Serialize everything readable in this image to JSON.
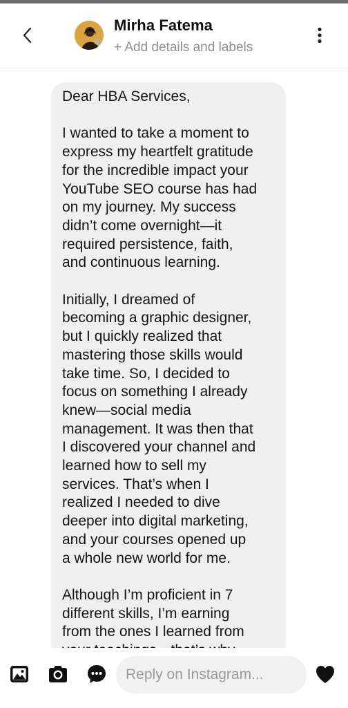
{
  "header": {
    "name": "Mirha Fatema",
    "subtitle": "+ Add details and labels"
  },
  "icons": {
    "back": "chevron-left-icon",
    "more": "vertical-ellipsis-icon",
    "gallery": "gallery-icon",
    "camera": "camera-icon",
    "sticker": "chat-bubble-icon",
    "like": "heart-icon"
  },
  "message": {
    "paragraphs": [
      [
        "Dear HBA Services,"
      ],
      [
        "I wanted to take a moment to",
        "express my heartfelt gratitude",
        "for the incredible impact your",
        "YouTube SEO course has had",
        "on my journey. My success",
        "didn’t come overnight—it",
        "required persistence, faith,",
        "and continuous learning."
      ],
      [
        "Initially, I dreamed of",
        "becoming a graphic designer,",
        "but I quickly realized that",
        "mastering those skills would",
        "take time. So, I decided to",
        "focus on something I already",
        "knew—social media",
        "management. It was then that",
        "I discovered your channel and",
        "learned how to sell my",
        "services. That’s when I",
        "realized I needed to dive",
        "deeper into digital marketing,",
        "and your courses opened up",
        "a whole new world for me."
      ],
      [
        "Although I’m proficient in 7",
        "different skills, I’m earning",
        "from the ones I learned from",
        "your teachings—that’s why"
      ]
    ]
  },
  "composer": {
    "placeholder": "Reply on Instagram..."
  },
  "colors": {
    "bubble": "#efefef",
    "subtitle": "#8e8e8e",
    "input": "#f1f1f1"
  }
}
